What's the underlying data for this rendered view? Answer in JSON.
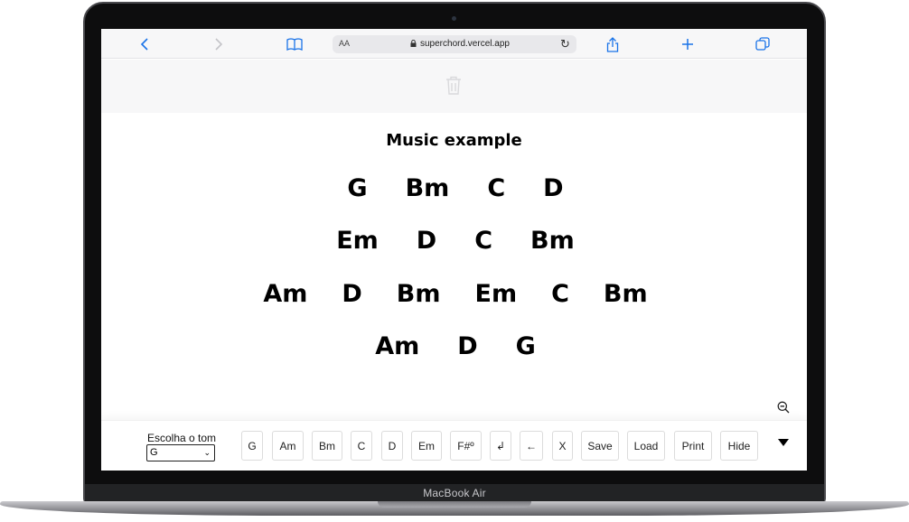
{
  "device": {
    "label": "MacBook Air"
  },
  "browser": {
    "url": "superchord.vercel.app",
    "reader_label": "AA",
    "icons": [
      "back-icon",
      "forward-icon",
      "bookmarks-icon",
      "lock-icon",
      "reload-icon",
      "share-icon",
      "new-tab-icon",
      "tabs-icon"
    ]
  },
  "song": {
    "title": "Music example",
    "lines": [
      [
        "G",
        "Bm",
        "C",
        "D"
      ],
      [
        "Em",
        "D",
        "C",
        "Bm"
      ],
      [
        "Am",
        "D",
        "Bm",
        "Em",
        "C",
        "Bm"
      ],
      [
        "Am",
        "D",
        "G"
      ]
    ]
  },
  "controls": {
    "tone_label": "Escolha o tom",
    "tone_value": "G",
    "chord_buttons": [
      "G",
      "Am",
      "Bm",
      "C",
      "D",
      "Em",
      "F#º"
    ],
    "newline_label": "↲",
    "backspace_label": "←",
    "clear_label": "X",
    "save_label": "Save",
    "load_label": "Load",
    "print_label": "Print",
    "hide_label": "Hide"
  }
}
